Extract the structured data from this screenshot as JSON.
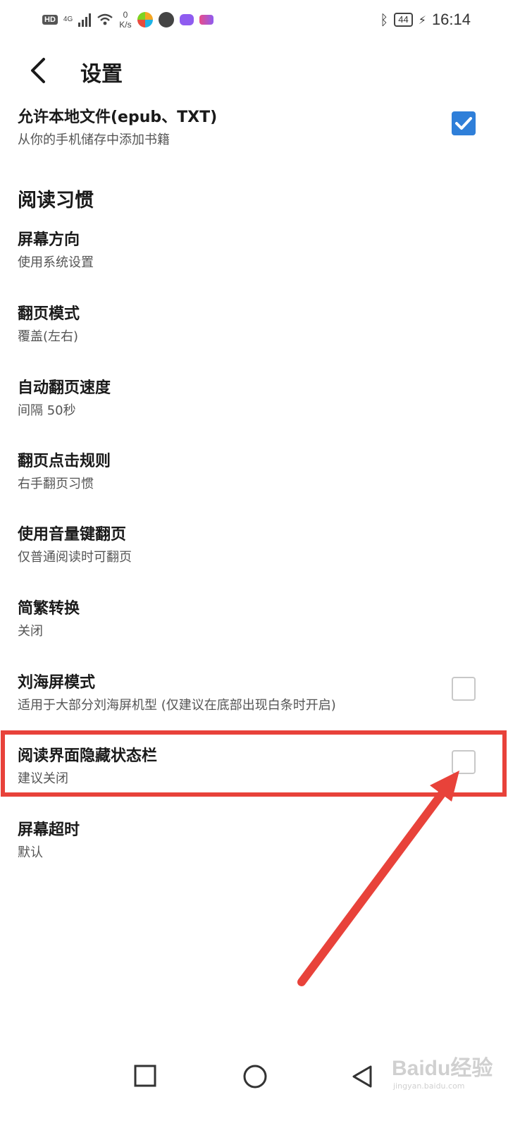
{
  "status_bar": {
    "hd": "HD",
    "network": "4G",
    "speed_value": "0",
    "speed_unit": "K/s",
    "battery": "44",
    "time": "16:14"
  },
  "header": {
    "title": "设置"
  },
  "settings": {
    "local_files": {
      "title": "允许本地文件(epub、TXT)",
      "subtitle": "从你的手机储存中添加书籍",
      "checked": true
    },
    "section_reading": "阅读习惯",
    "orientation": {
      "title": "屏幕方向",
      "subtitle": "使用系统设置"
    },
    "page_mode": {
      "title": "翻页模式",
      "subtitle": "覆盖(左右)"
    },
    "auto_speed": {
      "title": "自动翻页速度",
      "subtitle": "间隔 50秒"
    },
    "tap_rule": {
      "title": "翻页点击规则",
      "subtitle": "右手翻页习惯"
    },
    "volume_keys": {
      "title": "使用音量键翻页",
      "subtitle": "仅普通阅读时可翻页"
    },
    "trad_simp": {
      "title": "简繁转换",
      "subtitle": "关闭"
    },
    "notch_mode": {
      "title": "刘海屏模式",
      "subtitle": "适用于大部分刘海屏机型 (仅建议在底部出现白条时开启)",
      "checked": false
    },
    "hide_status": {
      "title": "阅读界面隐藏状态栏",
      "subtitle": "建议关闭",
      "checked": false
    },
    "screen_timeout": {
      "title": "屏幕超时",
      "subtitle": "默认"
    }
  },
  "watermark": {
    "logo": "Baidu经验",
    "url": "jingyan.baidu.com"
  },
  "colors": {
    "accent": "#2f7fd9",
    "annotation": "#e8423a"
  }
}
